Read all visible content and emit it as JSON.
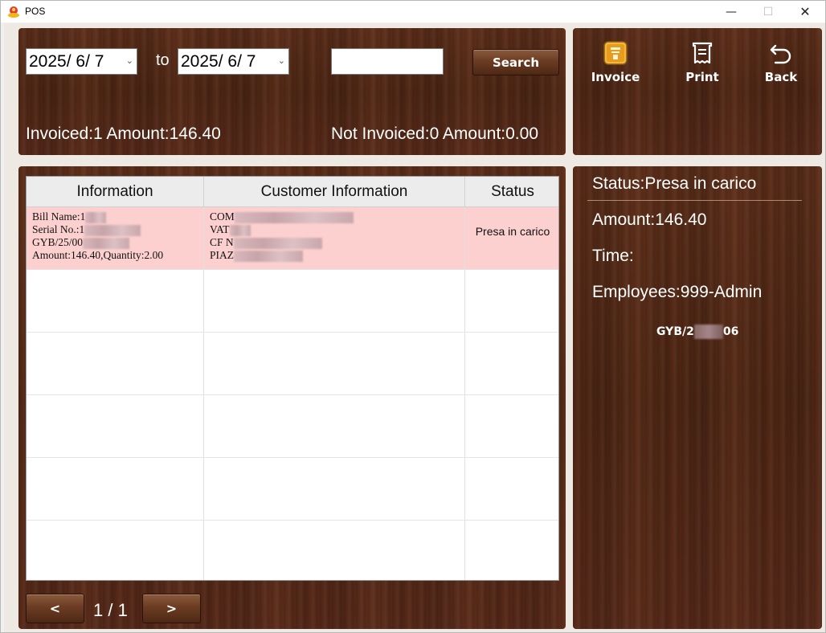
{
  "window": {
    "title": "POS",
    "minimize_glyph": "—",
    "maximize_glyph": "☐",
    "close_glyph": "✕"
  },
  "filters": {
    "date_from": "2025/  6/  7",
    "to_label": "to",
    "date_to": "2025/  6/  7",
    "search_value": "",
    "search_label": "Search"
  },
  "summary": {
    "invoiced": "Invoiced:1 Amount:146.40",
    "not_invoiced": "Not Invoiced:0 Amount:0.00"
  },
  "toolbar": {
    "invoice_label": "Invoice",
    "print_label": "Print",
    "back_label": "Back"
  },
  "table": {
    "columns": [
      "Information",
      "Customer Information",
      "Status"
    ],
    "rows": [
      {
        "info": [
          "Bill Name:1",
          "Serial No.:1",
          "GYB/25/00",
          "Amount:146.40,Quantity:2.00"
        ],
        "customer": [
          "COM",
          "VAT",
          "CF N",
          "PIAZ"
        ],
        "status": "Presa in carico"
      }
    ]
  },
  "pagination": {
    "prev_label": "<",
    "next_label": ">",
    "page_text": "1 / 1"
  },
  "detail": {
    "status": "Status:Presa in carico",
    "amount": "Amount:146.40",
    "time": "Time:",
    "employees": "Employees:999-Admin",
    "serial_prefix": "GYB/2",
    "serial_suffix": "06"
  },
  "colors": {
    "wood_dark": "#4a2514",
    "selected_row": "#fdd0d0",
    "header_bg": "#ececec"
  },
  "icons": {
    "invoice": "invoice-icon",
    "print": "receipt-icon",
    "back": "undo-arrow-icon"
  }
}
